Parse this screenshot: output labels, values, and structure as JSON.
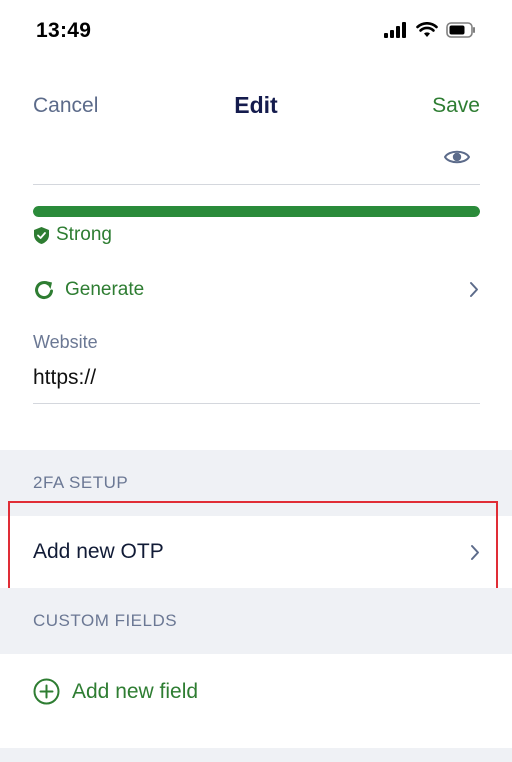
{
  "status_bar": {
    "time": "13:49",
    "icons": [
      "signal-icon",
      "wifi-icon",
      "battery-icon"
    ]
  },
  "nav": {
    "cancel_label": "Cancel",
    "title": "Edit",
    "save_label": "Save"
  },
  "password": {
    "strength_label": "Strong",
    "strength_fraction": 1.0,
    "strength_color": "#2a8b3a"
  },
  "generate": {
    "label": "Generate"
  },
  "website": {
    "label": "Website",
    "value": "https://"
  },
  "two_fa": {
    "header": "2FA SETUP",
    "add_otp_label": "Add new OTP"
  },
  "custom_fields": {
    "header": "CUSTOM FIELDS",
    "add_field_label": "Add new field"
  },
  "colors": {
    "accent_green": "#2e7d32",
    "highlight_red": "#e02d36",
    "section_bg": "#eff1f5"
  }
}
